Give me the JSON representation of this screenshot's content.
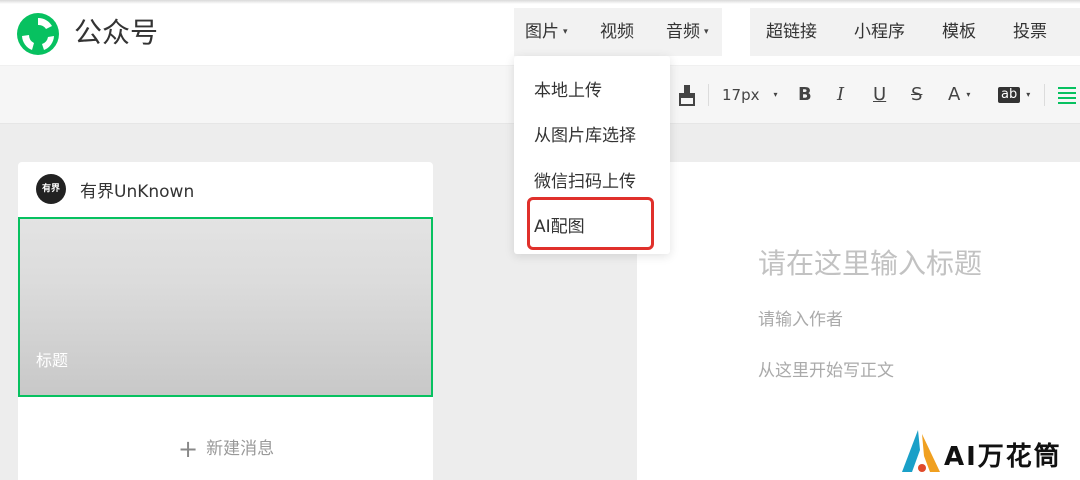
{
  "header": {
    "brand": "公众号",
    "nav": {
      "image": "图片",
      "video": "视频",
      "audio": "音频",
      "hyperlink": "超链接",
      "mini_program": "小程序",
      "template": "模板",
      "vote": "投票"
    },
    "caret": "▾"
  },
  "dropdown": {
    "items": [
      "本地上传",
      "从图片库选择",
      "微信扫码上传",
      "AI配图"
    ]
  },
  "toolbar": {
    "font_size": "17px",
    "bold": "B",
    "italic": "I",
    "underline": "U",
    "strikethrough": "S",
    "font_color": "A",
    "bg_color": "ab",
    "caret": "▾"
  },
  "left_panel": {
    "account_name": "有界UnKnown",
    "avatar_text": "有界",
    "article_title": "标题",
    "new_message": "新建消息",
    "plus": "+"
  },
  "editor": {
    "title_placeholder": "请在这里输入标题",
    "author_placeholder": "请输入作者",
    "body_placeholder": "从这里开始写正文"
  },
  "watermark": {
    "text": "AI万花筒"
  },
  "colors": {
    "brand_green": "#07c160",
    "highlight_red": "#e0302b"
  },
  "icons": {
    "logo": "wechat-official-account-logo",
    "format_painter": "format-painter-icon",
    "align": "align-icon"
  }
}
